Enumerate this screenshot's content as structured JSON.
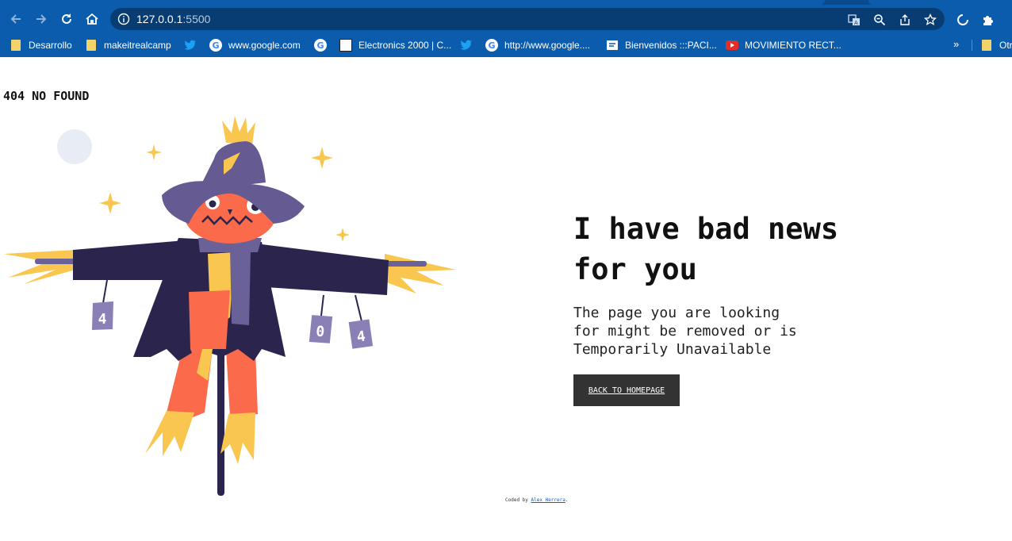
{
  "browser": {
    "url_host": "127.0.0.1",
    "url_port": ":5500",
    "bookmarks": [
      {
        "label": "Desarrollo",
        "icon": "folder-icon"
      },
      {
        "label": "makeitrealcamp",
        "icon": "folder-icon"
      },
      {
        "label": "",
        "icon": "twitter-icon"
      },
      {
        "label": "www.google.com",
        "icon": "google-icon"
      },
      {
        "label": "",
        "icon": "google-icon"
      },
      {
        "label": "Electronics 2000 | C...",
        "icon": "electronics-site-icon"
      },
      {
        "label": "",
        "icon": "twitter-icon"
      },
      {
        "label": "http://www.google....",
        "icon": "google-icon"
      },
      {
        "label": "Bienvenidos :::PACI...",
        "icon": "site-icon"
      },
      {
        "label": "MOVIMIENTO RECT...",
        "icon": "youtube-icon"
      },
      {
        "label": "Otr",
        "icon": "folder-icon"
      }
    ],
    "more_bookmarks": "»",
    "colors": {
      "chrome": "#0b5cad",
      "omnibox": "#083d73"
    }
  },
  "page": {
    "title": "404 NO FOUND",
    "illustration_cans": [
      "4",
      "0",
      "4"
    ],
    "headline": "I have bad news for you",
    "message": "The page you are looking for might be removed or is Temporarily Unavailable",
    "button_label": "BACK TO HOMEPAGE",
    "footer_prefix": "Coded by ",
    "footer_link": "Alex Herrera",
    "footer_suffix": ".",
    "colors": {
      "button": "#333333",
      "scarecrow_coat": "#2b254d",
      "scarecrow_face": "#fa6a4b",
      "hat": "#655a91",
      "straw": "#f9c74f"
    }
  }
}
